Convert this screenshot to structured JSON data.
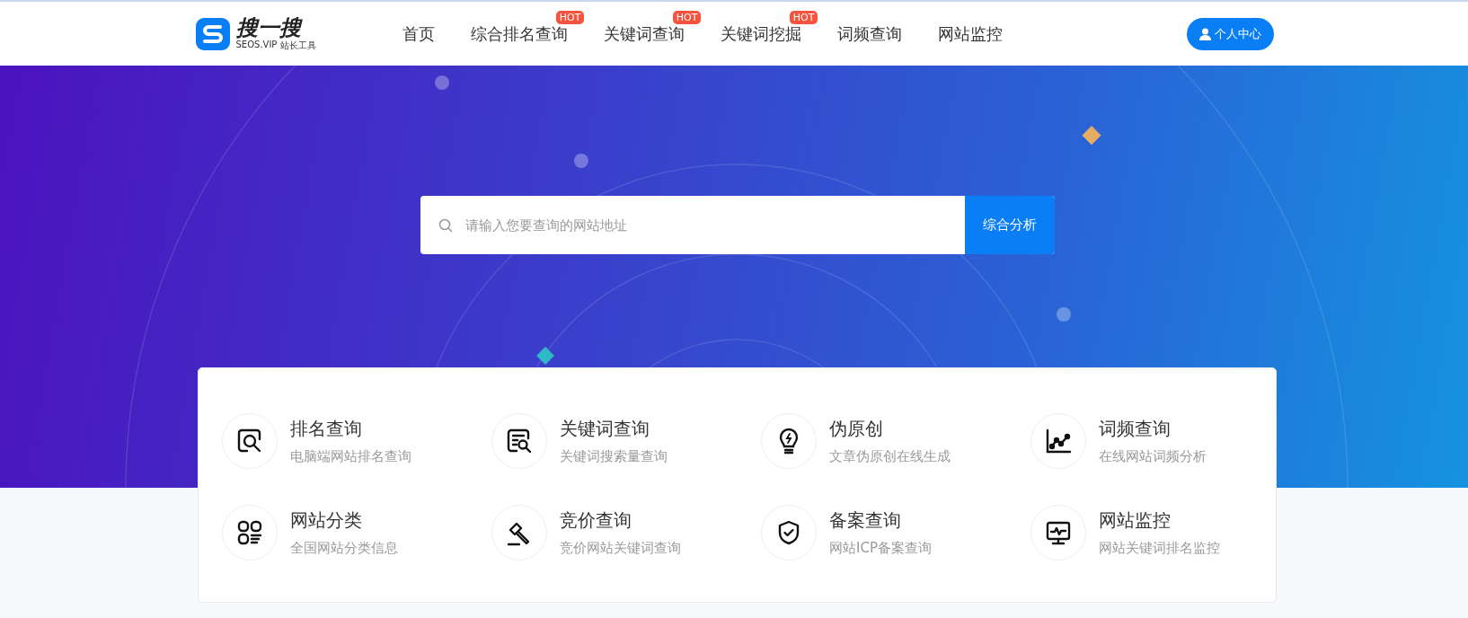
{
  "header": {
    "logo": {
      "name": "搜一搜",
      "domain": "SEOS.VIP",
      "tagline": "站长工具"
    },
    "nav": [
      {
        "label": "首页"
      },
      {
        "label": "综合排名查询",
        "badge": "HOT"
      },
      {
        "label": "关键词查询",
        "badge": "HOT"
      },
      {
        "label": "关键词挖掘",
        "badge": "HOT"
      },
      {
        "label": "词频查询"
      },
      {
        "label": "网站监控"
      }
    ],
    "user_button": "个人中心"
  },
  "search": {
    "placeholder": "请输入您要查询的网站地址",
    "button": "综合分析"
  },
  "tools": [
    {
      "kind": "rank",
      "title": "排名查询",
      "subtitle": "电脑端网站排名查询"
    },
    {
      "kind": "keyword",
      "title": "关键词查询",
      "subtitle": "关键词搜索量查询"
    },
    {
      "kind": "rewrite",
      "title": "伪原创",
      "subtitle": "文章伪原创在线生成"
    },
    {
      "kind": "frequency",
      "title": "词频查询",
      "subtitle": "在线网站词频分析"
    },
    {
      "kind": "category",
      "title": "网站分类",
      "subtitle": "全国网站分类信息"
    },
    {
      "kind": "bid",
      "title": "竞价查询",
      "subtitle": "竞价网站关键词查询"
    },
    {
      "kind": "icp",
      "title": "备案查询",
      "subtitle": "网站ICP备案查询"
    },
    {
      "kind": "monitor",
      "title": "网站监控",
      "subtitle": "网站关键词排名监控"
    }
  ]
}
